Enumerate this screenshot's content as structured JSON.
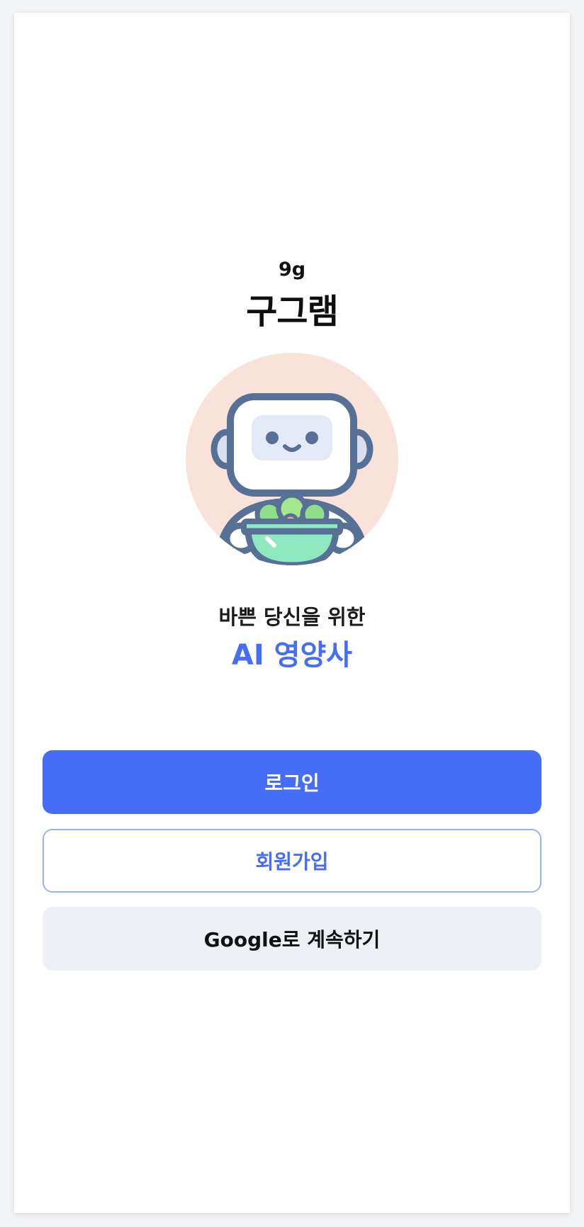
{
  "brand": {
    "small": "9g",
    "large": "구그램"
  },
  "mascot": {
    "icon": "robot-with-salad-bowl-icon",
    "background_color": "#f8e2da"
  },
  "tagline": {
    "line1": "바쁜 당신을 위한",
    "line2": "AI 영양사"
  },
  "actions": {
    "login_label": "로그인",
    "signup_label": "회원가입",
    "google_label": "Google로 계속하기"
  },
  "colors": {
    "accent": "#456df5",
    "signup_border": "#9fb2ee",
    "google_bg": "#edf1f6",
    "text_dark": "#111111"
  }
}
